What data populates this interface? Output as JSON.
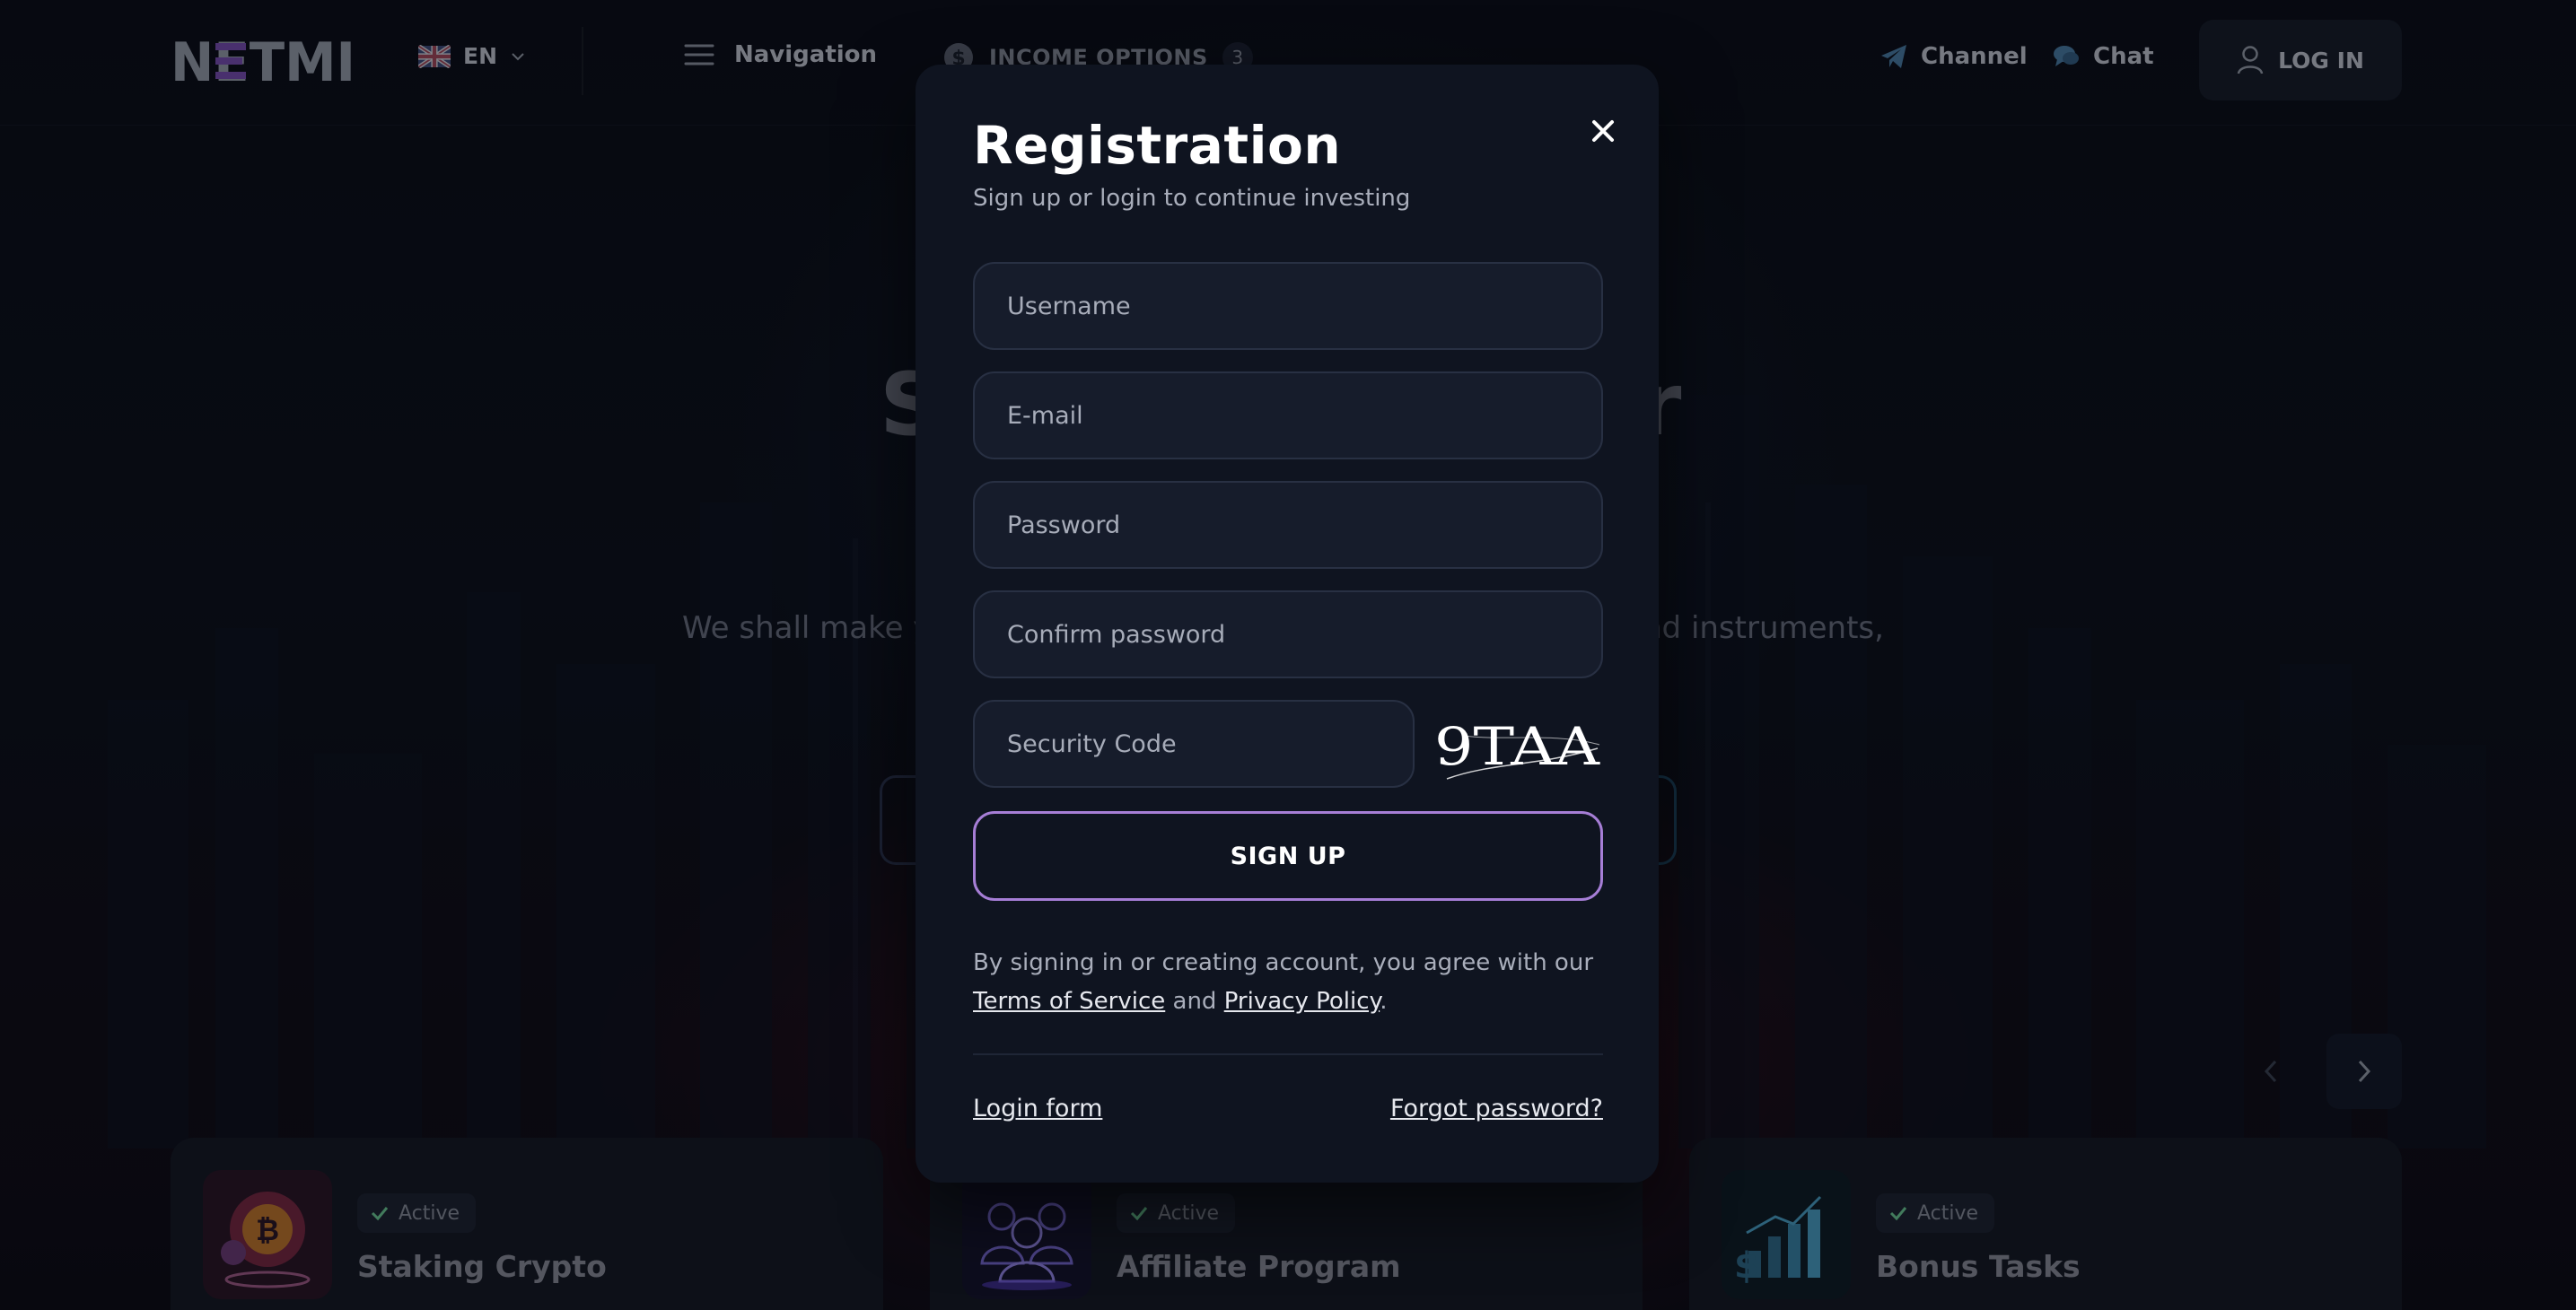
{
  "header": {
    "logo_text": "NETMI",
    "language": "EN",
    "navigation_label": "Navigation",
    "income_options_label": "INCOME OPTIONS",
    "income_options_count": "3",
    "channel_label": "Channel",
    "chat_label": "Chat",
    "login_label": "LOG IN"
  },
  "hero": {
    "title_left_fragment": "S",
    "title_right_fragment": "r",
    "subtitle_left_fragment": "We shall make y",
    "subtitle_right_fragment": "nd instruments,"
  },
  "cards": [
    {
      "status": "Active",
      "title": "Staking Crypto",
      "icon": "bitcoin-stack-icon"
    },
    {
      "status": "Active",
      "title": "Affiliate Program",
      "icon": "people-group-icon"
    },
    {
      "status": "Active",
      "title": "Bonus Tasks",
      "icon": "chart-growth-icon"
    }
  ],
  "modal": {
    "title": "Registration",
    "subtitle": "Sign up or login to continue investing",
    "fields": {
      "username_placeholder": "Username",
      "email_placeholder": "E-mail",
      "password_placeholder": "Password",
      "confirm_placeholder": "Confirm password",
      "security_placeholder": "Security Code"
    },
    "captcha_text": "9TAA",
    "signup_label": "SIGN UP",
    "legal": {
      "prefix": "By signing in or creating account, you agree with our ",
      "terms": "Terms of Service",
      "and": " and ",
      "privacy": "Privacy Policy",
      "suffix": "."
    },
    "login_form_link": "Login form",
    "forgot_password_link": "Forgot password?"
  },
  "colors": {
    "modal_bg": "#0f1420",
    "field_bg": "#161c2b",
    "signup_border": "#a67ed6",
    "accent_purple": "#7a4fb5",
    "status_green": "#6fcf97"
  }
}
